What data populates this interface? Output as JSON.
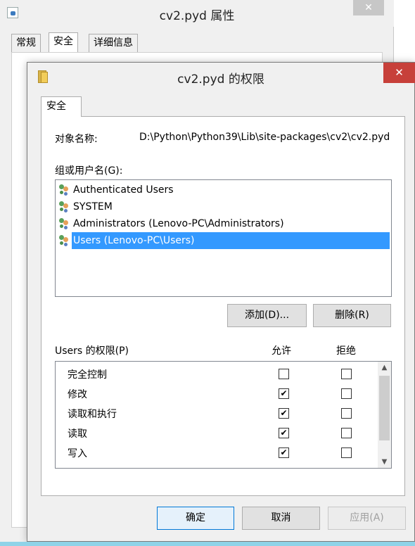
{
  "background_window": {
    "title": "cv2.pyd 属性",
    "close_glyph": "✕",
    "tabs": [
      "常规",
      "安全",
      "详细信息"
    ]
  },
  "dialog": {
    "title": "cv2.pyd 的权限",
    "close_glyph": "✕",
    "tab": "安全",
    "object_name_label": "对象名称:",
    "object_name_value": "D:\\Python\\Python39\\Lib\\site-packages\\cv2\\cv2.pyd",
    "groups_label": "组或用户名(G):",
    "users": [
      {
        "name": "Authenticated Users",
        "selected": false
      },
      {
        "name": "SYSTEM",
        "selected": false
      },
      {
        "name": "Administrators (Lenovo-PC\\Administrators)",
        "selected": false
      },
      {
        "name": "Users (Lenovo-PC\\Users)",
        "selected": true
      }
    ],
    "add_button": "添加(D)...",
    "remove_button": "删除(R)",
    "permissions_label": "Users 的权限(P)",
    "allow_header": "允许",
    "deny_header": "拒绝",
    "permissions": [
      {
        "name": "完全控制",
        "allow": false,
        "deny": false
      },
      {
        "name": "修改",
        "allow": true,
        "deny": false
      },
      {
        "name": "读取和执行",
        "allow": true,
        "deny": false
      },
      {
        "name": "读取",
        "allow": true,
        "deny": false
      },
      {
        "name": "写入",
        "allow": true,
        "deny": false
      }
    ],
    "ok_button": "确定",
    "cancel_button": "取消",
    "apply_button": "应用(A)",
    "selection_color": "#3399ff",
    "close_color": "#c7403a"
  }
}
